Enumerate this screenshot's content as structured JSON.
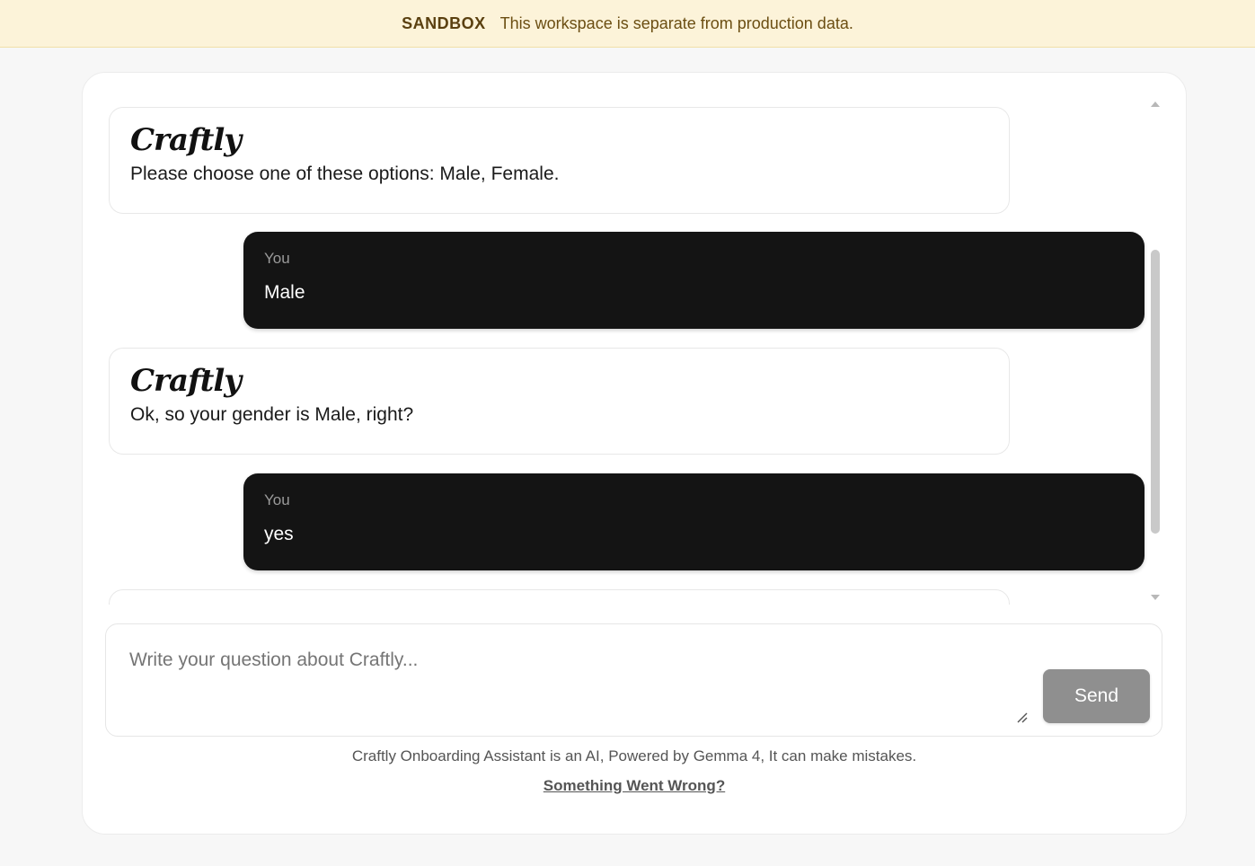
{
  "banner": {
    "tag": "SANDBOX",
    "message": "This workspace is separate from production data."
  },
  "messages": [
    {
      "role": "bot",
      "sender": "Craftly",
      "text": "Please choose one of these options: Male, Female."
    },
    {
      "role": "user",
      "sender": "You",
      "text": "Male"
    },
    {
      "role": "bot",
      "sender": "Craftly",
      "text": "Ok, so your gender is Male, right?"
    },
    {
      "role": "user",
      "sender": "You",
      "text": "yes"
    }
  ],
  "composer": {
    "placeholder": "Write your question about Craftly...",
    "value": "",
    "send_label": "Send"
  },
  "footer": {
    "disclaimer": "Craftly Onboarding Assistant is an AI, Powered by Gemma 4, It can make mistakes.",
    "report_link": "Something Went Wrong?"
  },
  "colors": {
    "banner_bg": "#fcf3d9",
    "user_bubble": "#141414",
    "send_button": "#8f8f8f"
  }
}
